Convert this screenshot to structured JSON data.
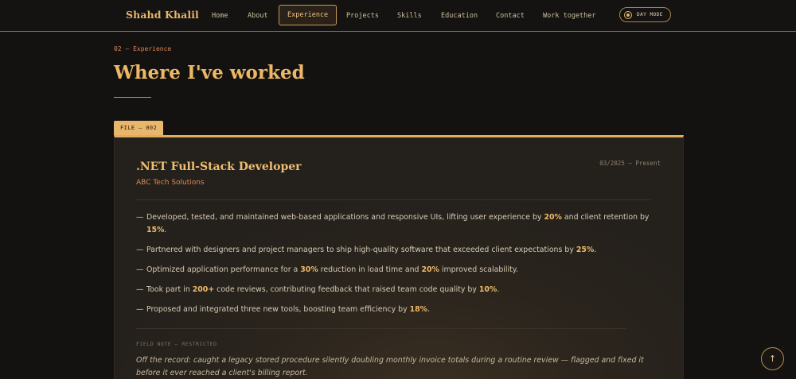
{
  "nav": {
    "brand": "Shahd Khalil",
    "links": [
      "Home",
      "About",
      "Experience",
      "Projects",
      "Skills",
      "Education",
      "Contact",
      "Work together"
    ],
    "active_index": 2,
    "mode_toggle": "DAY MODE"
  },
  "section": {
    "eyebrow": "02 — Experience",
    "title": "Where I've worked"
  },
  "card": {
    "file_tab": "FILE — 002",
    "job_title": ".NET Full-Stack Developer",
    "date": "03/2025 — Present",
    "company": "ABC Tech Solutions",
    "bullets": [
      {
        "dash": "—",
        "parts": [
          "Developed, tested, and maintained web-based applications and responsive UIs, lifting user experience by ",
          "20%",
          " and client retention by ",
          "15%",
          "."
        ]
      },
      {
        "dash": "—",
        "parts": [
          "Partnered with designers and project managers to ship high-quality software that exceeded client expectations by ",
          "25%",
          "."
        ]
      },
      {
        "dash": "—",
        "parts": [
          "Optimized application performance for a ",
          "30%",
          " reduction in load time and ",
          "20%",
          " improved scalability."
        ]
      },
      {
        "dash": "—",
        "parts": [
          "Took part in ",
          "200+",
          " code reviews, contributing feedback that raised team code quality by ",
          "10%",
          "."
        ]
      },
      {
        "dash": "—",
        "parts": [
          "Proposed and integrated three new tools, boosting team efficiency by ",
          "18%",
          "."
        ]
      }
    ],
    "note_label": "FIELD NOTE — RESTRICTED",
    "note_text": "Off the record: caught a legacy stored procedure silently doubling monthly invoice totals during a routine review — flagged and fixed it before it ever reached a client's billing report."
  },
  "to_top": "↑",
  "colors": {
    "background": "#141210",
    "accent": "#e6b56a",
    "accent_secondary": "#d9855a"
  }
}
